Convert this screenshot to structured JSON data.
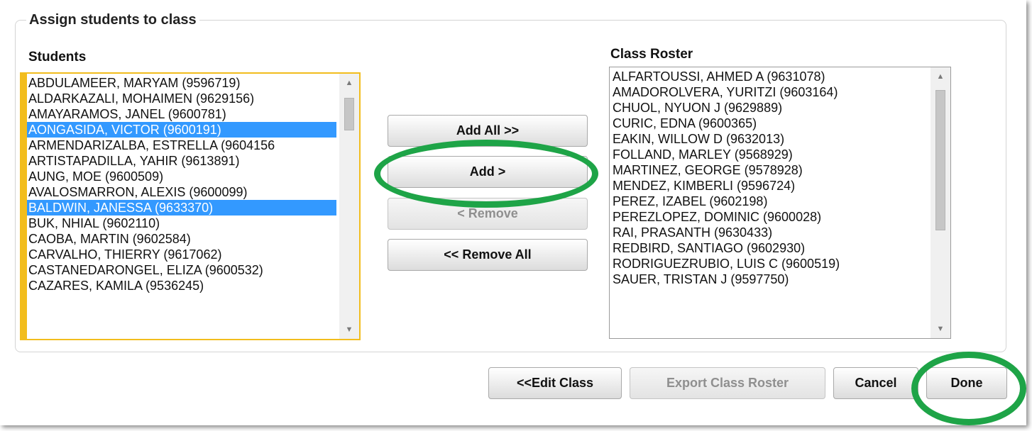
{
  "dialog": {
    "title": "Assign students to class",
    "students_label": "Students",
    "roster_label": "Class Roster"
  },
  "students": {
    "items": [
      "ABDULAMEER, MARYAM (9596719)",
      "ALDARKAZALI, MOHAIMEN (9629156)",
      "AMAYARAMOS, JANEL (9600781)",
      "AONGASIDA, VICTOR (9600191)",
      "ARMENDARIZALBA, ESTRELLA (9604156",
      "ARTISTAPADILLA, YAHIR (9613891)",
      "AUNG, MOE (9600509)",
      "AVALOSMARRON, ALEXIS (9600099)",
      "BALDWIN, JANESSA (9633370)",
      "BUK, NHIAL (9602110)",
      "CAOBA, MARTIN (9602584)",
      "CARVALHO, THIERRY (9617062)",
      "CASTANEDARONGEL, ELIZA (9600532)",
      "CAZARES, KAMILA (9536245)"
    ],
    "selected": [
      3,
      8
    ]
  },
  "roster": {
    "items": [
      "ALFARTOUSSI, AHMED A (9631078)",
      "AMADOROLVERA, YURITZI (9603164)",
      "CHUOL, NYUON J (9629889)",
      "CURIC, EDNA (9600365)",
      "EAKIN, WILLOW D (9632013)",
      "FOLLAND, MARLEY (9568929)",
      "MARTINEZ, GEORGE (9578928)",
      "MENDEZ, KIMBERLI (9596724)",
      "PEREZ, IZABEL (9602198)",
      "PEREZLOPEZ, DOMINIC (9600028)",
      "RAI, PRASANTH (9630433)",
      "REDBIRD, SANTIAGO (9602930)",
      "RODRIGUEZRUBIO, LUIS C (9600519)",
      "SAUER, TRISTAN J (9597750)"
    ]
  },
  "transfer": {
    "add_all": "Add All >>",
    "add": "Add >",
    "remove": "< Remove",
    "remove_all": "<< Remove All"
  },
  "footer": {
    "edit_class": "<<Edit Class",
    "export": "Export Class Roster",
    "cancel": "Cancel",
    "done": "Done"
  },
  "colors": {
    "selection": "#3399ff",
    "focus_border": "#f2bd1d",
    "highlight_ring": "#1ea447"
  },
  "icons": {
    "scroll_up": "▲",
    "scroll_down": "▼"
  }
}
